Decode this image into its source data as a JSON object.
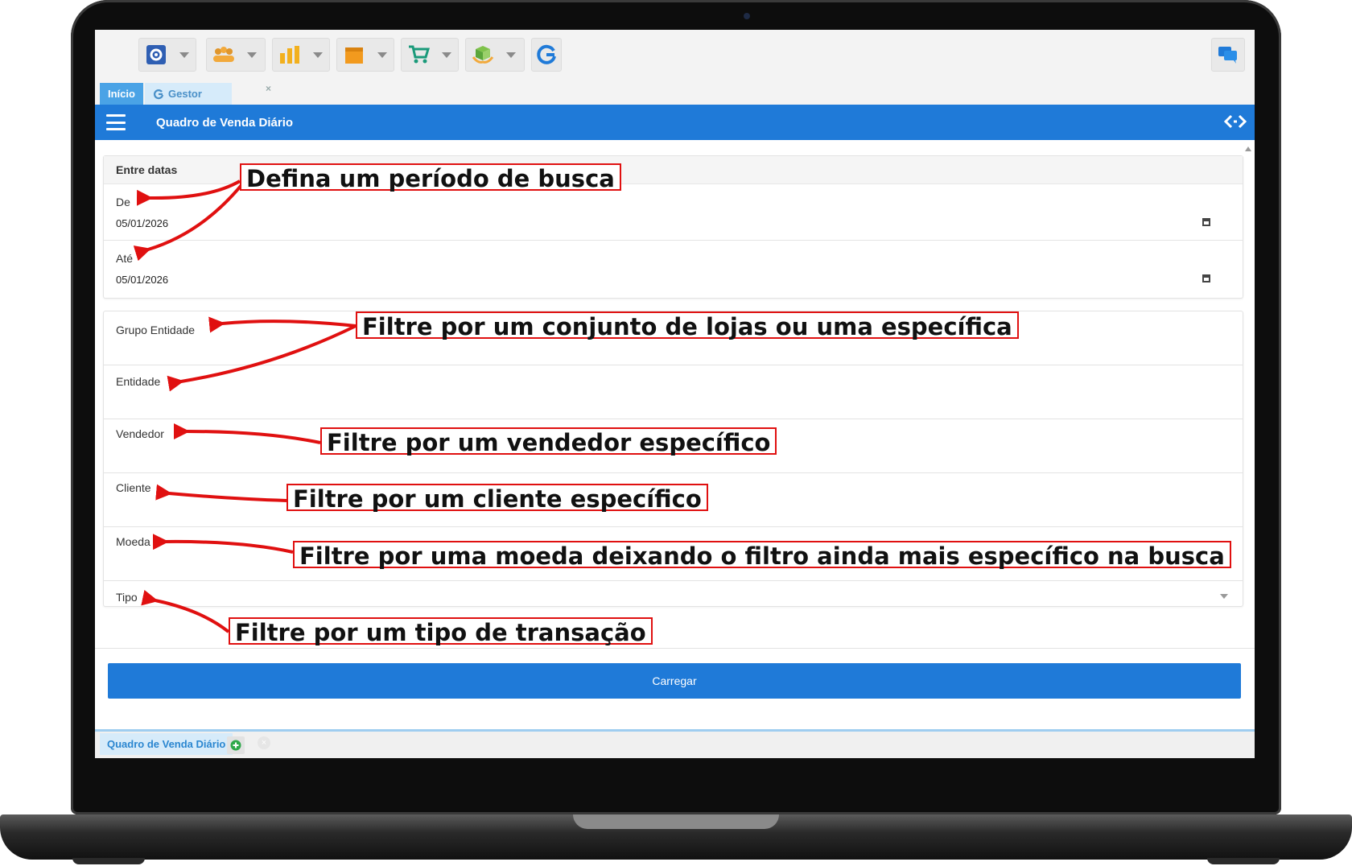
{
  "tabs": {
    "inicio": "Início",
    "gestor": "Gestor",
    "close": "×"
  },
  "header": {
    "title": "Quadro de Venda Diário"
  },
  "dates": {
    "section_title": "Entre datas",
    "from_label": "De",
    "from_value": "05/01/2026",
    "to_label": "Até",
    "to_value": "05/01/2026"
  },
  "filters": {
    "grupo_entidade": "Grupo Entidade",
    "entidade": "Entidade",
    "vendedor": "Vendedor",
    "cliente": "Cliente",
    "moeda": "Moeda",
    "tipo": "Tipo"
  },
  "actions": {
    "carregar": "Carregar"
  },
  "bottom_tabs": {
    "active": "Quadro de Venda Diário",
    "add": "+"
  },
  "annotations": {
    "periodo": "Defina um período de busca",
    "lojas": "Filtre por um conjunto de lojas ou uma específica",
    "vendedor": "Filtre por um vendedor específico",
    "cliente": "Filtre por um cliente específico",
    "moeda": "Filtre por uma moeda deixando o filtro ainda mais específico na busca",
    "tipo": "Filtre por um tipo de transação"
  },
  "icons": {
    "toolbar": [
      "settings-icon",
      "users-icon",
      "bar-chart-icon",
      "box-icon",
      "cart-icon",
      "package-hand-icon",
      "refresh-g-icon"
    ],
    "header": [
      "hamburger-menu-icon",
      "code-toggle-icon"
    ],
    "chat": "chat-icon"
  },
  "colors": {
    "primary": "#1f7ad8",
    "annotation": "#e01010",
    "tab_active": "#4aa3e6"
  }
}
